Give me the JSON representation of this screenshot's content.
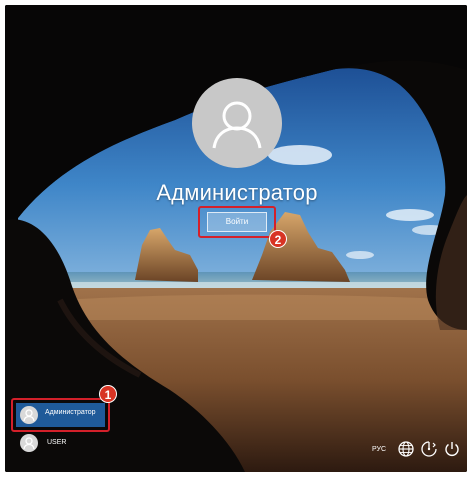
{
  "user": {
    "name": "Администратор"
  },
  "signin": {
    "label": "Войти"
  },
  "badges": {
    "first": "1",
    "second": "2"
  },
  "user_list": [
    {
      "label": "Администратор",
      "selected": true
    },
    {
      "label": "USER",
      "selected": false
    }
  ],
  "tray": {
    "language": "РУС",
    "icons": [
      "network-globe-icon",
      "ease-of-access-icon",
      "power-icon"
    ]
  },
  "colors": {
    "highlight_outline": "#d4202a",
    "badge": "#d83424",
    "selected_tile": "#1f5a99"
  }
}
